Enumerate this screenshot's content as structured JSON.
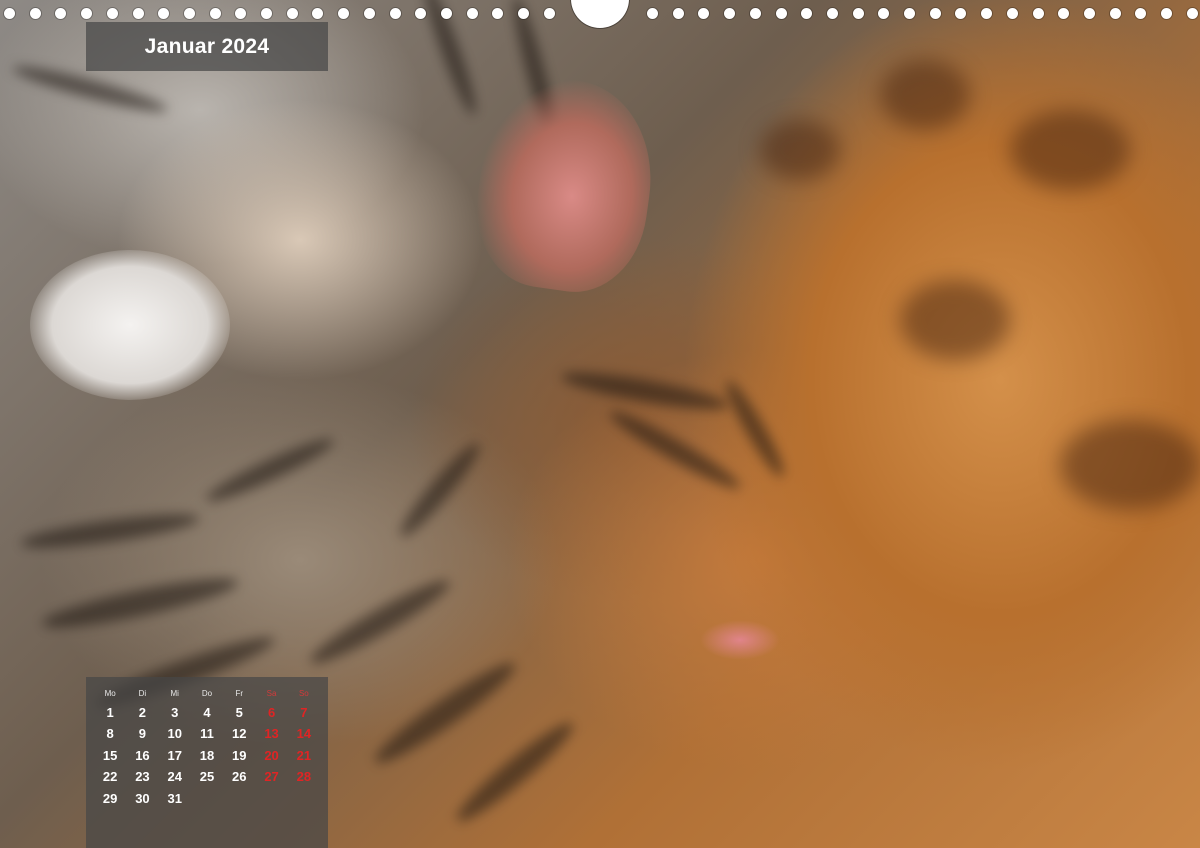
{
  "calendar": {
    "title": "Januar 2024",
    "weekdays": [
      "Mo",
      "Di",
      "Mi",
      "Do",
      "Fr",
      "Sa",
      "So"
    ],
    "weekend_color": "#e02424",
    "weeks": [
      [
        "1",
        "2",
        "3",
        "4",
        "5",
        "6",
        "7"
      ],
      [
        "8",
        "9",
        "10",
        "11",
        "12",
        "13",
        "14"
      ],
      [
        "15",
        "16",
        "17",
        "18",
        "19",
        "20",
        "21"
      ],
      [
        "22",
        "23",
        "24",
        "25",
        "26",
        "27",
        "28"
      ],
      [
        "29",
        "30",
        "31",
        "",
        "",
        "",
        ""
      ]
    ]
  },
  "photo": {
    "subject": "two sleeping bengal kittens"
  }
}
